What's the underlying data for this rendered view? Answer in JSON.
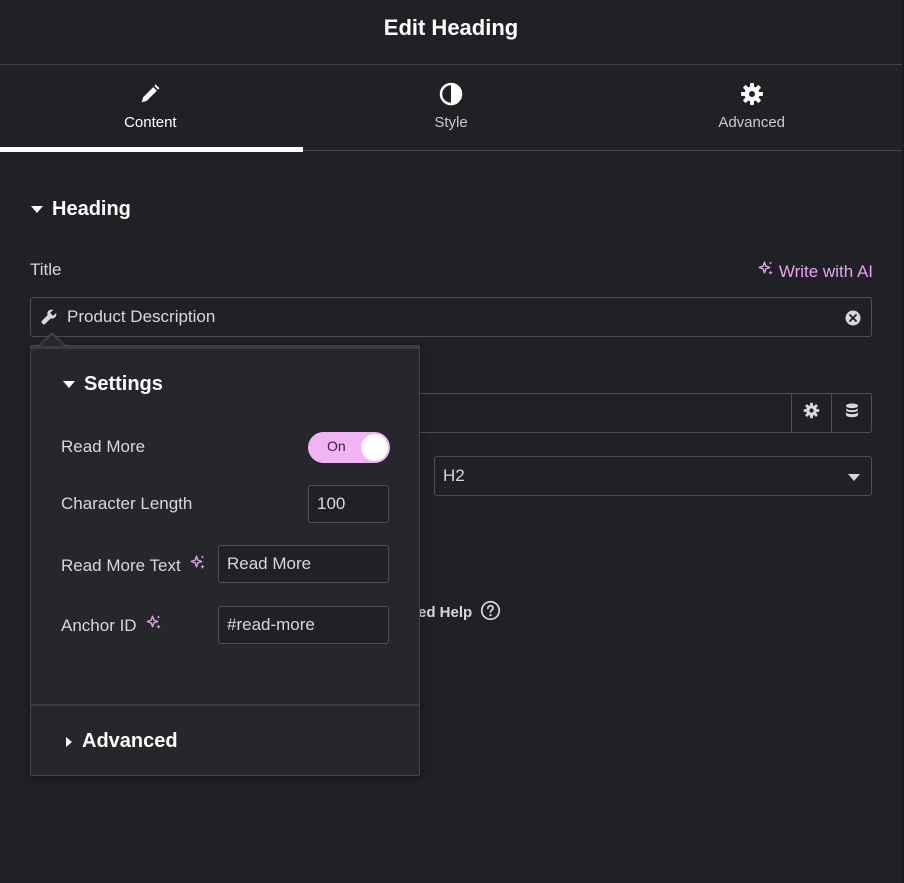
{
  "header": {
    "title": "Edit Heading"
  },
  "tabs": [
    {
      "label": "Content",
      "icon": "pencil-icon",
      "active": true
    },
    {
      "label": "Style",
      "icon": "half-circle-icon",
      "active": false
    },
    {
      "label": "Advanced",
      "icon": "gear-icon",
      "active": false
    }
  ],
  "section": {
    "title": "Heading"
  },
  "title_field": {
    "label": "Title",
    "ai_link": "Write with AI",
    "value": "Product Description"
  },
  "tag_select": {
    "value": "H2"
  },
  "help": {
    "text": "ed Help"
  },
  "popover": {
    "section_title": "Settings",
    "read_more": {
      "label": "Read More",
      "toggle_text": "On",
      "enabled": true
    },
    "character_length": {
      "label": "Character Length",
      "value": "100"
    },
    "read_more_text": {
      "label": "Read More Text",
      "value": "Read More"
    },
    "anchor_id": {
      "label": "Anchor ID",
      "value": "#read-more"
    },
    "advanced_title": "Advanced"
  },
  "colors": {
    "background": "#202124",
    "accent_ai": "#e7a3f3",
    "toggle_on": "#f2b3f6",
    "active_tab_bar": "#ffffff"
  }
}
